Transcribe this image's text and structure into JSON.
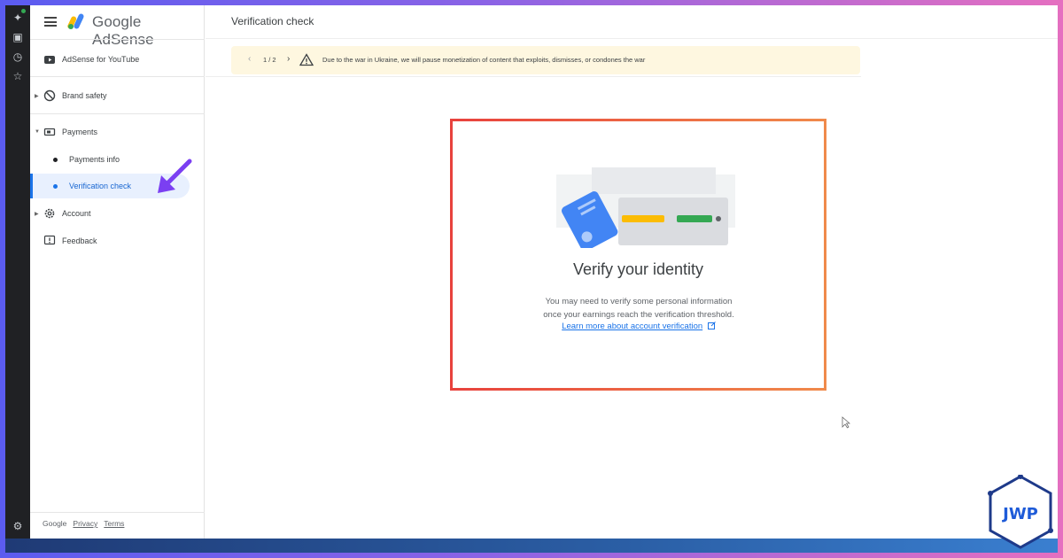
{
  "app": {
    "brand_name": "Google AdSense",
    "page_title": "Verification check"
  },
  "sidebar": {
    "items": [
      {
        "label": "AdSense for YouTube",
        "icon": "youtube-icon"
      },
      {
        "label": "Brand safety",
        "icon": "block-icon"
      },
      {
        "label": "Payments",
        "icon": "payments-icon"
      },
      {
        "label": "Account",
        "icon": "gear-icon"
      },
      {
        "label": "Feedback",
        "icon": "feedback-icon"
      }
    ],
    "sub_items": [
      {
        "label": "Payments info",
        "active": false
      },
      {
        "label": "Verification check",
        "active": true
      }
    ],
    "footer": {
      "brand": "Google",
      "privacy": "Privacy",
      "terms": "Terms"
    }
  },
  "banner": {
    "count": "1 / 2",
    "text": "Due to the war in Ukraine, we will pause monetization of content that exploits, dismisses, or condones the war"
  },
  "card": {
    "title": "Verify your identity",
    "description_line1": "You may need to verify some personal information",
    "description_line2": "once your earnings reach the verification threshold.",
    "link": "Learn more about account verification"
  },
  "colors": {
    "accent": "#1a73e8",
    "banner_bg": "#fef7e0",
    "card_border_start": "#e8423d",
    "card_border_end": "#f08a4b",
    "arrow": "#7b3ff2"
  },
  "watermark": "JWP"
}
